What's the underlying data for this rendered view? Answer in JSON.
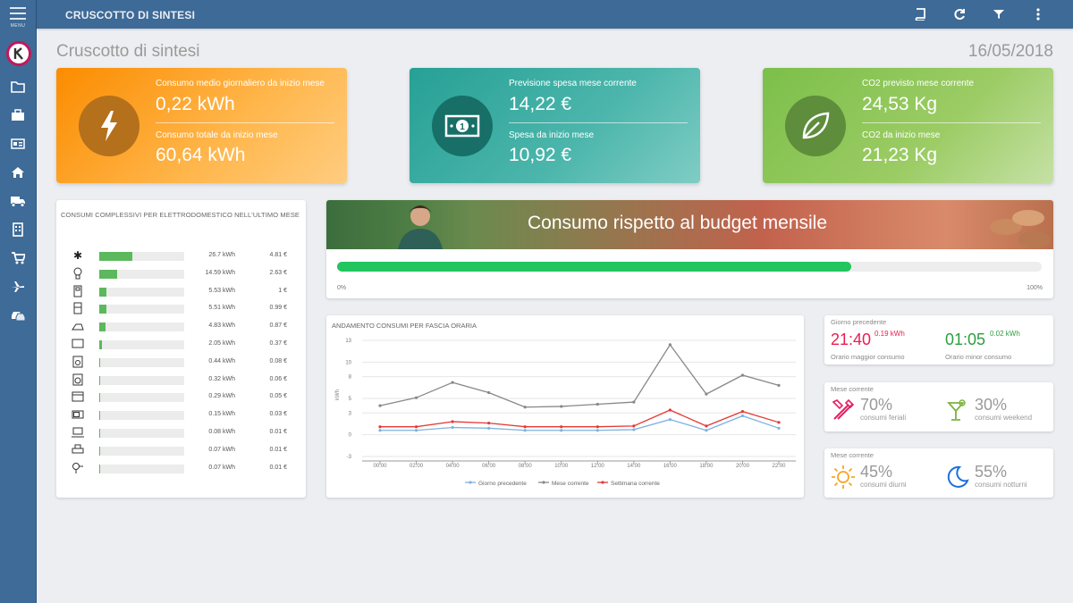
{
  "app": {
    "title": "CRUSCOTTO DI SINTESI",
    "menu_label": "MENU"
  },
  "page": {
    "title": "Cruscotto di sintesi",
    "date": "16/05/2018"
  },
  "sidebar_icons": [
    "folder-icon",
    "briefcase-icon",
    "id-card-icon",
    "home-icon",
    "truck-icon",
    "building-icon",
    "cart-icon",
    "airplane-icon",
    "cars-icon"
  ],
  "toolbar_icons": [
    "book-icon",
    "refresh-icon",
    "filter-icon",
    "more-vert-icon"
  ],
  "kpi": [
    {
      "label1": "Consumo medio giornaliero da inizio mese",
      "value1": "0,22 kWh",
      "label2": "Consumo totale da inizio mese",
      "value2": "60,64 kWh",
      "icon": "lightning-icon",
      "color": "#f7a233"
    },
    {
      "label1": "Previsione spesa mese corrente",
      "value1": "14,22 €",
      "label2": "Spesa da inizio mese",
      "value2": "10,92 €",
      "icon": "banknote-icon",
      "color": "#2a9f9a"
    },
    {
      "label1": "CO2 previsto mese corrente",
      "value1": "24,53 Kg",
      "label2": "CO2 da inizio mese",
      "value2": "21,23 Kg",
      "icon": "leaf-icon",
      "color": "#8ec95c"
    }
  ],
  "appliances": {
    "title": "CONSUMI COMPLESSIVI PER ELETTRODOMESTICO NELL'ULTIMO MESE",
    "rows": [
      {
        "icon": "asterisk-icon",
        "kwh": "26.7 kWh",
        "eur": "4.81 €",
        "share": 0.39
      },
      {
        "icon": "lightbulb-icon",
        "kwh": "14.59 kWh",
        "eur": "2.63 €",
        "share": 0.21
      },
      {
        "icon": "fridge-icon",
        "kwh": "5.53 kWh",
        "eur": "1 €",
        "share": 0.08
      },
      {
        "icon": "fridge-small-icon",
        "kwh": "5.51 kWh",
        "eur": "0.99 €",
        "share": 0.08
      },
      {
        "icon": "iron-icon",
        "kwh": "4.83 kWh",
        "eur": "0.87 €",
        "share": 0.07
      },
      {
        "icon": "tv-icon",
        "kwh": "2.05 kWh",
        "eur": "0.37 €",
        "share": 0.03
      },
      {
        "icon": "coffee-machine-icon",
        "kwh": "0.44 kWh",
        "eur": "0.08 €",
        "share": 0.01
      },
      {
        "icon": "washer-icon",
        "kwh": "0.32 kWh",
        "eur": "0.06 €",
        "share": 0.01
      },
      {
        "icon": "oven-icon",
        "kwh": "0.29 kWh",
        "eur": "0.05 €",
        "share": 0.01
      },
      {
        "icon": "microwave-icon",
        "kwh": "0.15 kWh",
        "eur": "0.03 €",
        "share": 0.005
      },
      {
        "icon": "laptop-icon",
        "kwh": "0.08 kWh",
        "eur": "0.01 €",
        "share": 0.003
      },
      {
        "icon": "printer-icon",
        "kwh": "0.07 kWh",
        "eur": "0.01 €",
        "share": 0.003
      },
      {
        "icon": "hairdryer-icon",
        "kwh": "0.07 kWh",
        "eur": "0.01 €",
        "share": 0.003
      }
    ]
  },
  "budget": {
    "title": "Consumo rispetto al budget mensile",
    "progress": 0.73,
    "min_label": "0%",
    "max_label": "100%"
  },
  "chart_data": {
    "type": "line",
    "title": "ANDAMENTO CONSUMI PER FASCIA ORARIA",
    "ylabel": "kWh",
    "ylim": [
      -3,
      13
    ],
    "yticks": [
      "13",
      "10",
      "8",
      "5",
      "3",
      "0",
      "-3"
    ],
    "x": [
      "00:00",
      "02:00",
      "04:00",
      "06:00",
      "08:00",
      "10:00",
      "12:00",
      "14:00",
      "16:00",
      "18:00",
      "20:00",
      "22:00"
    ],
    "legend_position": "bottom",
    "series": [
      {
        "name": "Giorno precedente",
        "color": "#7fb3e0",
        "values": [
          0.6,
          0.6,
          1.0,
          0.9,
          0.6,
          0.6,
          0.6,
          0.7,
          2.1,
          0.6,
          2.6,
          0.9
        ]
      },
      {
        "name": "Mese corrente",
        "color": "#888888",
        "values": [
          4.0,
          5.1,
          7.2,
          5.8,
          3.8,
          3.9,
          4.2,
          4.5,
          12.4,
          5.6,
          8.2,
          6.8
        ]
      },
      {
        "name": "Settimana corrente",
        "color": "#e53935",
        "values": [
          1.1,
          1.1,
          1.8,
          1.6,
          1.1,
          1.1,
          1.1,
          1.2,
          3.4,
          1.2,
          3.2,
          1.7
        ]
      }
    ]
  },
  "giorno": {
    "header": "Giorno precedente",
    "max_time": "21:40",
    "max_value": "0.19 kWh",
    "max_label": "Orario maggior consumo",
    "min_time": "01:05",
    "min_value": "0.02 kWh",
    "min_label": "Orario minor consumo"
  },
  "mese1": {
    "header": "Mese corrente",
    "p1": "70%",
    "l1": "consumi feriali",
    "p2": "30%",
    "l2": "consumi weekend"
  },
  "mese2": {
    "header": "Mese corrente",
    "p1": "45%",
    "l1": "consumi diurni",
    "p2": "55%",
    "l2": "consumi notturni"
  }
}
